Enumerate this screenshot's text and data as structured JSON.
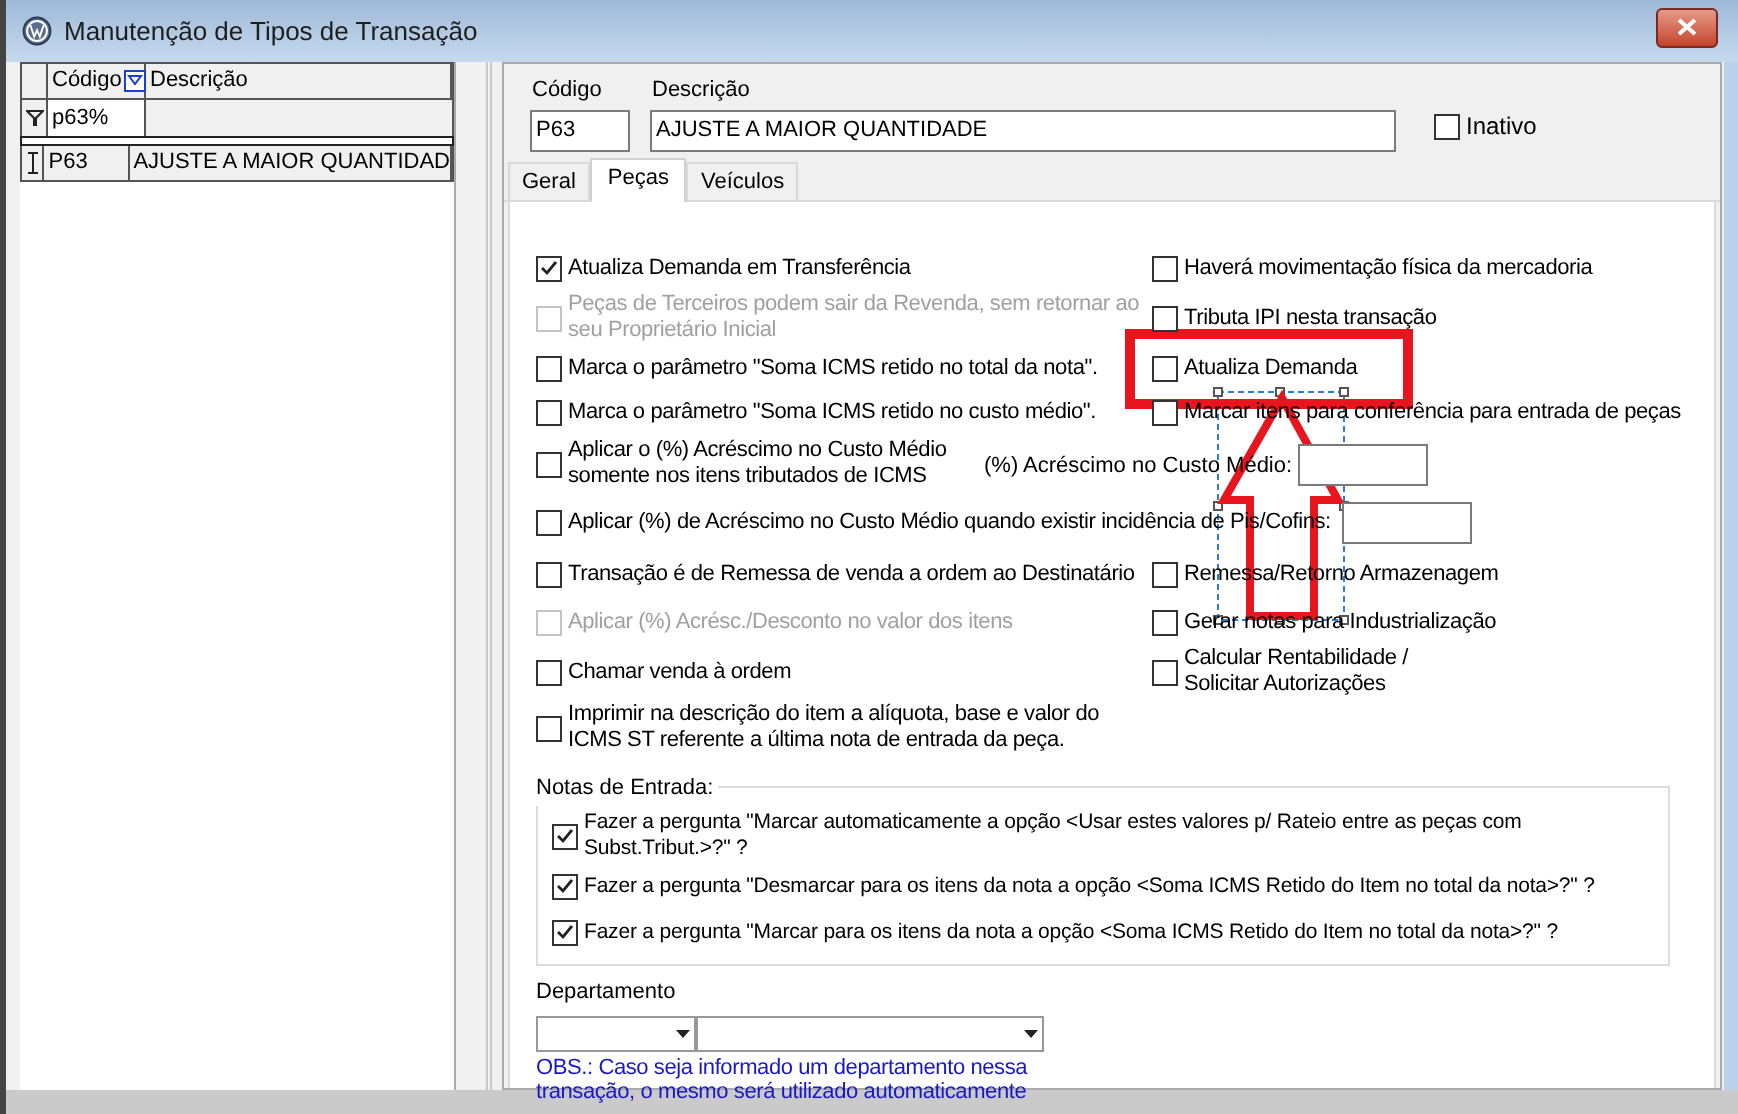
{
  "window": {
    "title": "Manutenção de Tipos de Transação"
  },
  "grid": {
    "columns": [
      {
        "label": "Código",
        "filter_icon": true
      },
      {
        "label": "Descrição",
        "filter_icon": false
      }
    ],
    "filter": "p63%",
    "rows": [
      {
        "cells": [
          "P63",
          "AJUSTE A MAIOR QUANTIDAD"
        ]
      }
    ]
  },
  "header": {
    "code": {
      "label": "Código",
      "value": "P63"
    },
    "description": {
      "label": "Descrição",
      "value": "AJUSTE A MAIOR QUANTIDADE"
    },
    "inactive": {
      "label": "Inativo",
      "checked": false
    }
  },
  "tabs": [
    {
      "label": "Geral",
      "selected": false
    },
    {
      "label": "Peças",
      "selected": true
    },
    {
      "label": "Veículos",
      "selected": false
    }
  ],
  "rows": [
    {
      "left": [
        {
          "kind": "checkbox",
          "label": "Atualiza Demanda em Transferência",
          "checked": true,
          "disabled": false
        }
      ],
      "right": [
        {
          "kind": "checkbox",
          "label": "Haverá movimentação física da mercadoria",
          "checked": false,
          "disabled": false
        }
      ]
    },
    {
      "left": [
        {
          "kind": "checkbox",
          "label": "Peças de Terceiros podem sair da Revenda, sem retornar ao seu Proprietário Inicial",
          "checked": false,
          "disabled": true
        }
      ],
      "right": [
        {
          "kind": "checkbox",
          "label": "Tributa IPI nesta transação",
          "checked": false,
          "disabled": false
        }
      ]
    },
    {
      "left": [
        {
          "kind": "checkbox",
          "label": "Marca o parâmetro \"Soma ICMS retido no total da nota\".",
          "checked": false,
          "disabled": false
        }
      ],
      "right": [
        {
          "kind": "checkbox",
          "label": "Atualiza Demanda",
          "checked": false,
          "disabled": false
        }
      ]
    },
    {
      "left": [
        {
          "kind": "checkbox",
          "label": "Marca o parâmetro \"Soma ICMS retido no custo médio\".",
          "checked": false,
          "disabled": false
        }
      ],
      "right": [
        {
          "kind": "checkbox",
          "label": "Marcar itens para conferência para entrada de peças",
          "checked": false,
          "disabled": false
        }
      ]
    },
    {
      "left": [
        {
          "kind": "checkbox",
          "label": "Aplicar o (%) Acréscimo no Custo Médio somente nos itens tributados de ICMS",
          "checked": false,
          "disabled": false
        },
        {
          "kind": "field",
          "label": "(%) Acréscimo no Custo Médio:"
        }
      ]
    },
    {
      "left": [
        {
          "kind": "checkbox",
          "label": "Aplicar (%) de Acréscimo no Custo Médio quando existir incidência de Pis/Cofins:",
          "checked": false,
          "disabled": false
        },
        {
          "kind": "field"
        }
      ]
    },
    {
      "left": [
        {
          "kind": "checkbox",
          "label": "Transação é de Remessa de venda a ordem ao Destinatário",
          "checked": false,
          "disabled": false
        }
      ],
      "right": [
        {
          "kind": "checkbox",
          "label": "Remessa/Retorno Armazenagem",
          "checked": false,
          "disabled": false
        }
      ]
    },
    {
      "left": [
        {
          "kind": "checkbox",
          "label": "Aplicar (%) Acrésc./Desconto no valor dos itens",
          "checked": false,
          "disabled": true
        }
      ],
      "right": [
        {
          "kind": "checkbox",
          "label": "Gerar notas para Industrialização",
          "checked": false,
          "disabled": false
        }
      ]
    },
    {
      "left": [
        {
          "kind": "checkbox",
          "label": "Chamar venda à ordem",
          "checked": false,
          "disabled": false
        }
      ],
      "right": [
        {
          "kind": "checkbox",
          "label": "Calcular Rentabilidade / Solicitar Autorizações",
          "checked": false,
          "disabled": false
        }
      ]
    },
    {
      "left": [
        {
          "kind": "checkbox",
          "label": "Imprimir na descrição do item a alíquota, base e valor do ICMS ST referente a última nota de entrada da peça.",
          "checked": false,
          "disabled": false
        }
      ]
    }
  ],
  "notes_group": {
    "title": "Notas de Entrada:",
    "options": [
      {
        "label": "Fazer a pergunta \"Marcar automaticamente a opção <Usar estes valores p/ Rateio entre as peças com Subst.Tribut.>?\" ?",
        "checked": true
      },
      {
        "label": "Fazer a pergunta \"Desmarcar para os itens da nota a opção <Soma ICMS Retido do Item no total da nota>?\" ?",
        "checked": true
      },
      {
        "label": "Fazer a pergunta \"Marcar para os itens da nota a opção <Soma ICMS Retido do Item no total da nota>?\" ?",
        "checked": true
      }
    ]
  },
  "department": {
    "label": "Departamento",
    "note": "OBS.: Caso seja informado um departamento nessa transação, o mesmo será utilizado automaticamente"
  }
}
